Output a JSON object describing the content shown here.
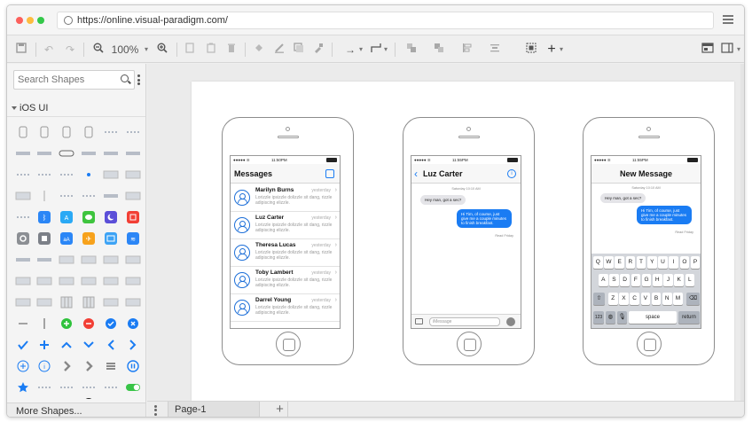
{
  "browser": {
    "url": "https://online.visual-paradigm.com/",
    "dot_colors": [
      "#fc605c",
      "#fdbc40",
      "#34c84a"
    ]
  },
  "toolbar": {
    "zoom": "100%",
    "icons": [
      "save-icon",
      "undo-icon",
      "redo-icon",
      "zoom-out-icon",
      "zoom-in-icon",
      "copy-icon",
      "paste-icon",
      "delete-icon",
      "fill-icon",
      "line-color-icon",
      "shadow-icon",
      "format-painter-icon",
      "connector-icon",
      "waypoint-icon",
      "to-front-icon",
      "to-back-icon",
      "align-icon",
      "distribute-icon",
      "group-icon",
      "insert-icon",
      "panel-icon",
      "layout-icon"
    ]
  },
  "sidebar": {
    "search_placeholder": "Search Shapes",
    "category": "iOS UI",
    "more_shapes": "More Shapes...",
    "accent": "#1a7cf3"
  },
  "page_tabs": {
    "current": "Page-1"
  },
  "phones": {
    "messages": {
      "time": "11:50PM",
      "title": "Messages",
      "items": [
        {
          "name": "Marilyn Burns",
          "time": "yesterday",
          "preview": "Lorizzle ipsizzle dolizzle sit dang, rizzle adipiscing elizzle."
        },
        {
          "name": "Luz Carter",
          "time": "yesterday",
          "preview": "Lorizzle ipsizzle dolizzle sit dang, rizzle adipiscing elizzle."
        },
        {
          "name": "Theresa Lucas",
          "time": "yesterday",
          "preview": "Lorizzle ipsizzle dolizzle sit dang, rizzle adipiscing elizzle."
        },
        {
          "name": "Toby Lambert",
          "time": "yesterday",
          "preview": "Lorizzle ipsizzle dolizzle sit dang, rizzle adipiscing elizzle."
        },
        {
          "name": "Darrel Young",
          "time": "yesterday",
          "preview": "Lorizzle ipsizzle dolizzle sit dang, rizzle adipiscing elizzle."
        }
      ]
    },
    "chat": {
      "time": "11:55PM",
      "title": "Luz Carter",
      "date": "Saturday 10:10 AM",
      "incoming": "Hey man, got a sec?",
      "outgoing": "Hi Tim, of course, just give me a couple minutes to finish breakfast.",
      "read": "Read Friday",
      "input_placeholder": "iMessage"
    },
    "new_message": {
      "time": "11:55PM",
      "title": "New Message",
      "date": "Saturday 10:10 AM",
      "incoming": "Hey man, got a sec?",
      "outgoing": "Hi Tim, of course, just give me a couple minutes to finish breakfast.",
      "read": "Read Friday",
      "keyboard": {
        "row1": [
          "Q",
          "W",
          "E",
          "R",
          "T",
          "Y",
          "U",
          "I",
          "O",
          "P"
        ],
        "row2": [
          "A",
          "S",
          "D",
          "F",
          "G",
          "H",
          "J",
          "K",
          "L"
        ],
        "row3": [
          "Z",
          "X",
          "C",
          "V",
          "B",
          "N",
          "M"
        ],
        "numbers": "123",
        "space": "space",
        "return": "return"
      }
    }
  }
}
